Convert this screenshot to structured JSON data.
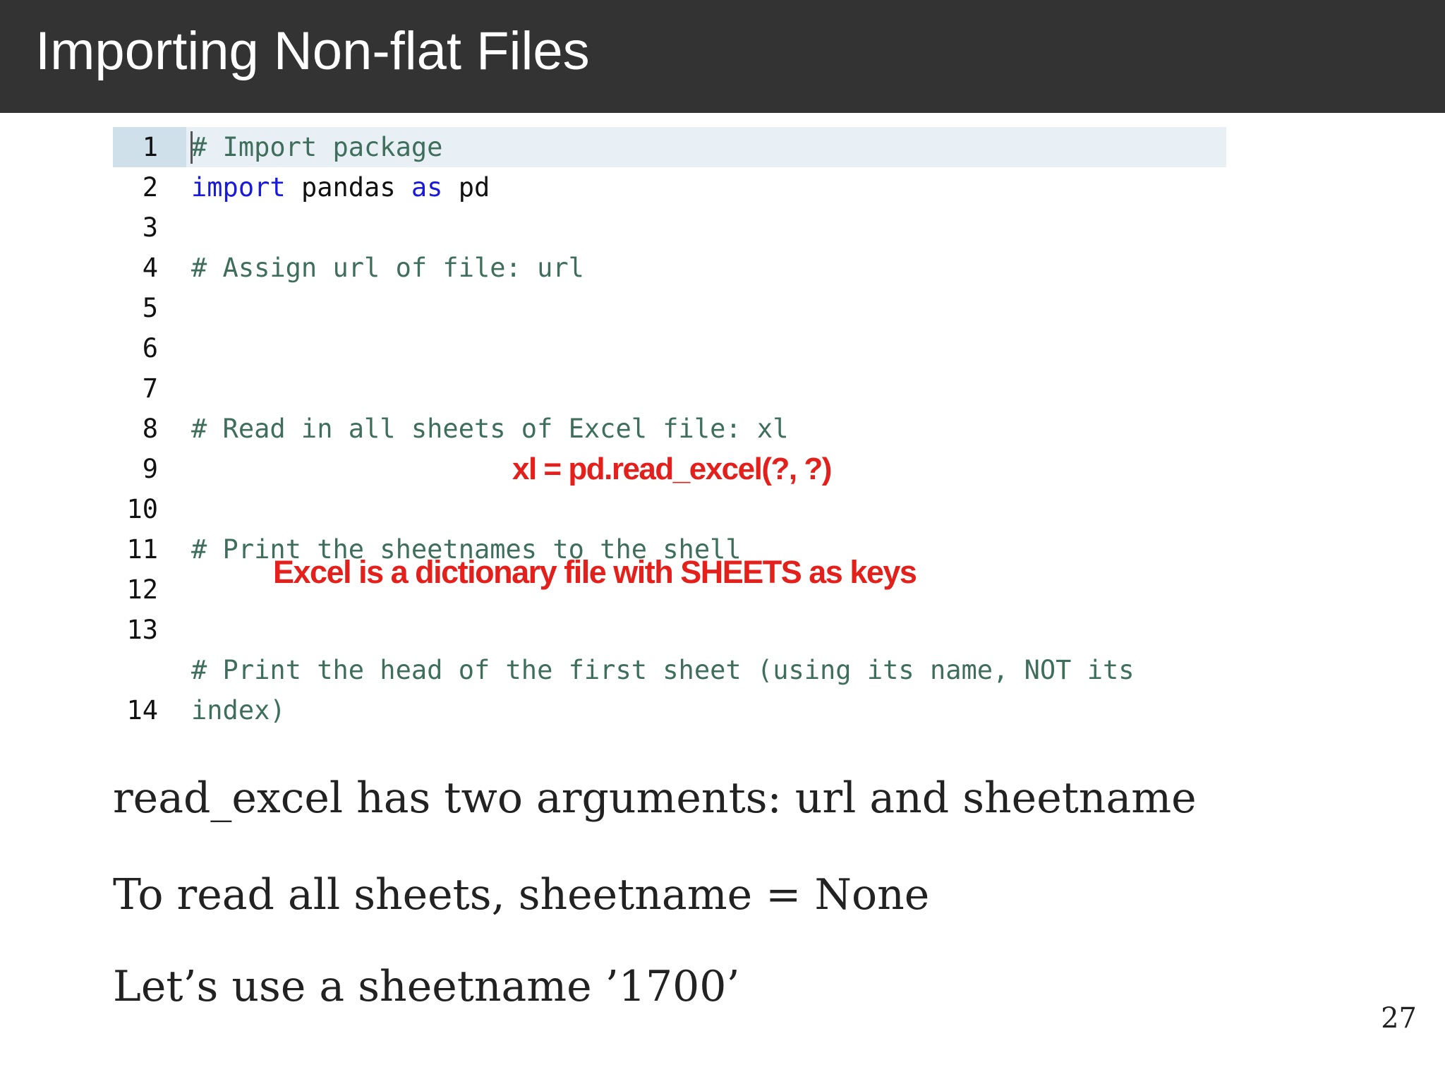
{
  "slide": {
    "title": "Importing Non-flat Files",
    "page_number": "27"
  },
  "code": {
    "line_numbers": [
      "1",
      "2",
      "3",
      "4",
      "5",
      "6",
      "7",
      "8",
      "9",
      "10",
      "11",
      "12",
      "13",
      "14"
    ],
    "line1_comment": "# Import package",
    "line2_kw_import": "import",
    "line2_module": "pandas",
    "line2_kw_as": "as",
    "line2_alias": "pd",
    "line4_comment": "# Assign url of file: url",
    "line7_comment": "# Read in all sheets of Excel file: xl",
    "line10_comment": "# Print the sheetnames to the shell",
    "line13_comment": "# Print the head of the first sheet (using its name, NOT its",
    "line13_continued": "index)"
  },
  "annotations": {
    "read_excel_hint": "xl = pd.read_excel(?, ?)",
    "dictionary_note": "Excel is a dictionary file with SHEETS as keys"
  },
  "bullets": [
    "read_excel has two arguments: url and sheetname",
    "To read all sheets, sheetname = None",
    "Let’s use a sheetname ’1700’"
  ],
  "colors": {
    "title_bar": "#333333",
    "comment": "#3f6f5c",
    "keyword": "#1a1adb",
    "annotation": "#e3201b",
    "highlight_line": "#e8f0f5"
  }
}
